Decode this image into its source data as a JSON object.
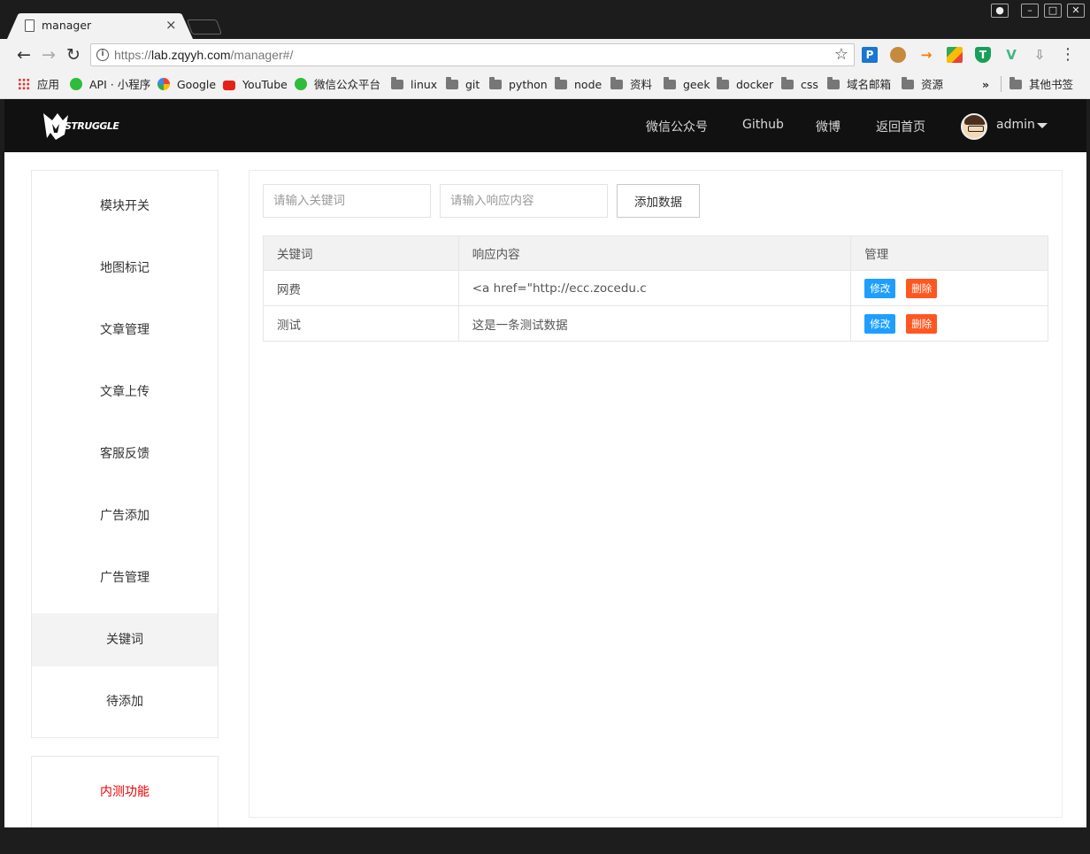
{
  "browser": {
    "tab_title": "manager",
    "url_scheme": "https://",
    "url_host": "lab.zqyyh.com",
    "url_path": "/manager#/",
    "bookmarks": [
      {
        "label": "应用",
        "icon": "apps-icon"
      },
      {
        "label": "API · 小程序",
        "icon": "wechat-icon"
      },
      {
        "label": "Google",
        "icon": "google-icon"
      },
      {
        "label": "YouTube",
        "icon": "youtube-icon"
      },
      {
        "label": "微信公众平台",
        "icon": "wechat-icon"
      },
      {
        "label": "linux",
        "icon": "folder-icon"
      },
      {
        "label": "git",
        "icon": "folder-icon"
      },
      {
        "label": "python",
        "icon": "folder-icon"
      },
      {
        "label": "node",
        "icon": "folder-icon"
      },
      {
        "label": "资料",
        "icon": "folder-icon"
      },
      {
        "label": "geek",
        "icon": "folder-icon"
      },
      {
        "label": "docker",
        "icon": "folder-icon"
      },
      {
        "label": "css",
        "icon": "folder-icon"
      },
      {
        "label": "域名邮箱",
        "icon": "folder-icon"
      },
      {
        "label": "资源",
        "icon": "folder-icon"
      }
    ],
    "other_bookmarks": "其他书签",
    "overflow": "»"
  },
  "header": {
    "logo_text": "STRUGGLE",
    "nav": [
      "微信公众号",
      "Github",
      "微博",
      "返回首页"
    ],
    "user": "admin"
  },
  "sidebar": {
    "items": [
      "模块开关",
      "地图标记",
      "文章管理",
      "文章上传",
      "客服反馈",
      "广告添加",
      "广告管理",
      "关键词",
      "待添加"
    ],
    "active_index": 7,
    "beta_item": "内测功能"
  },
  "form": {
    "keyword_placeholder": "请输入关键词",
    "response_placeholder": "请输入响应内容",
    "add_button": "添加数据"
  },
  "table": {
    "headers": [
      "关键词",
      "响应内容",
      "管理"
    ],
    "rows": [
      {
        "keyword": "网费",
        "response": "<a href=\"http://ecc.zocedu.c"
      },
      {
        "keyword": "测试",
        "response": "这是一条测试数据"
      }
    ],
    "edit_label": "修改",
    "delete_label": "删除"
  },
  "colors": {
    "header_bg": "#111111",
    "edit_button": "#1e9fff",
    "delete_button": "#ff5722",
    "beta_text": "#ee0000"
  }
}
